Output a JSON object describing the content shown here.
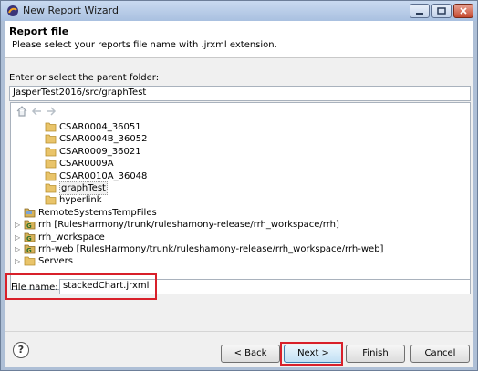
{
  "window": {
    "title": "New Report Wizard"
  },
  "header": {
    "title": "Report file",
    "description": "Please select your reports file name with .jrxml extension."
  },
  "folder": {
    "label": "Enter or select the parent folder:",
    "value": "JasperTest2016/src/graphTest"
  },
  "tree": {
    "items": [
      {
        "label": "CSAR0004_36051",
        "icon": "folder-icon",
        "expander": ""
      },
      {
        "label": "CSAR0004B_36052",
        "icon": "folder-icon",
        "expander": ""
      },
      {
        "label": "CSAR0009_36021",
        "icon": "folder-icon",
        "expander": ""
      },
      {
        "label": "CSAR0009A",
        "icon": "folder-icon",
        "expander": ""
      },
      {
        "label": "CSAR0010A_36048",
        "icon": "folder-icon",
        "expander": ""
      },
      {
        "label": "graphTest",
        "icon": "folder-icon",
        "expander": "",
        "selected": true
      },
      {
        "label": "hyperlink",
        "icon": "folder-icon",
        "expander": ""
      },
      {
        "label": "RemoteSystemsTempFiles",
        "icon": "project-icon",
        "expander": ""
      },
      {
        "label": "rrh [RulesHarmony/trunk/ruleshamony-release/rrh_workspace/rrh]",
        "icon": "svn-project-icon",
        "expander": "▷"
      },
      {
        "label": "rrh_workspace",
        "icon": "svn-project-icon",
        "expander": "▷"
      },
      {
        "label": "rrh-web [RulesHarmony/trunk/ruleshamony-release/rrh_workspace/rrh-web]",
        "icon": "svn-project-icon",
        "expander": "▷"
      },
      {
        "label": "Servers",
        "icon": "folder-icon",
        "expander": "▷"
      }
    ]
  },
  "filename": {
    "label": "File name:",
    "value": "stackedChart.jrxml"
  },
  "buttons": {
    "help": "?",
    "back": "< Back",
    "next": "Next >",
    "finish": "Finish",
    "cancel": "Cancel"
  },
  "colors": {
    "highlight": "#d8202a",
    "folder": "#e9c46a"
  }
}
